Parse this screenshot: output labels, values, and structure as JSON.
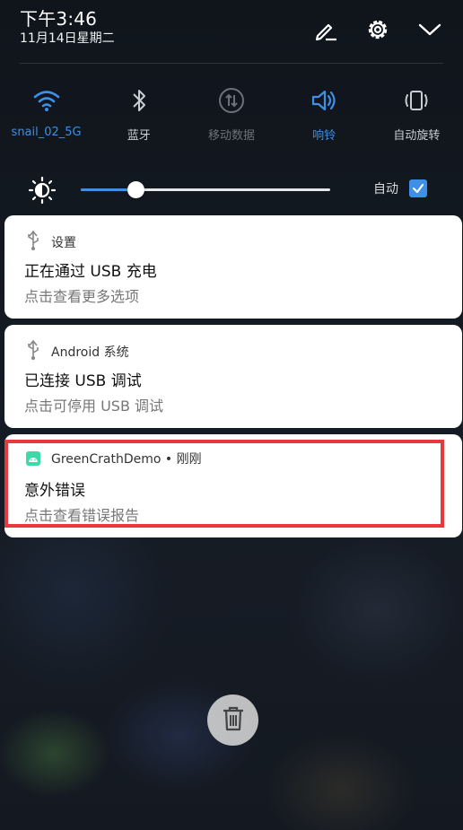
{
  "status": {
    "time": "下午3:46",
    "date": "11月14日星期二"
  },
  "top_actions": [
    {
      "name": "edit-icon"
    },
    {
      "name": "gear-icon"
    },
    {
      "name": "chevron-down-icon"
    }
  ],
  "toggles": [
    {
      "label": "snail_02_5G",
      "icon": "wifi-icon",
      "state": "on"
    },
    {
      "label": "蓝牙",
      "icon": "bluetooth-icon",
      "state": "off"
    },
    {
      "label": "移动数据",
      "icon": "mobile-data-icon",
      "state": "disabled"
    },
    {
      "label": "响铃",
      "icon": "sound-icon",
      "state": "on"
    },
    {
      "label": "自动旋转",
      "icon": "auto-rotate-icon",
      "state": "off"
    }
  ],
  "brightness": {
    "level": 0.22,
    "auto_label": "自动",
    "auto_checked": true
  },
  "notifications": [
    {
      "app": "设置",
      "icon": "usb-icon",
      "title": "正在通过 USB 充电",
      "text": "点击查看更多选项"
    },
    {
      "app": "Android 系统",
      "icon": "usb-icon",
      "title": "已连接 USB 调试",
      "text": "点击可停用 USB 调试"
    },
    {
      "app": "GreenCrathDemo • 刚刚",
      "icon": "android-app-icon",
      "title": "意外错误",
      "text": "点击查看错误报告"
    }
  ],
  "colors": {
    "accent": "#3d8fe8",
    "highlight": "#e8373d",
    "app_icon": "#3dd9a6"
  }
}
